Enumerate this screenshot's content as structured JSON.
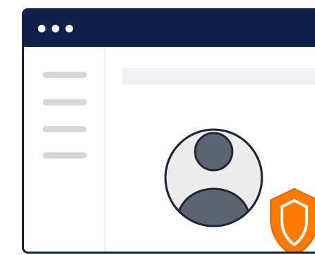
{
  "window": {
    "title_bar_color": "#0e2148",
    "controls": [
      "dot",
      "dot",
      "dot"
    ]
  },
  "sidebar": {
    "items": [
      "placeholder-line",
      "placeholder-line",
      "placeholder-line",
      "placeholder-line"
    ]
  },
  "content": {
    "search_bar": "placeholder",
    "profile": {
      "icon": "user-avatar-icon",
      "badge_icon": "security-shield-icon",
      "badge_color": "#ff7b00"
    }
  }
}
